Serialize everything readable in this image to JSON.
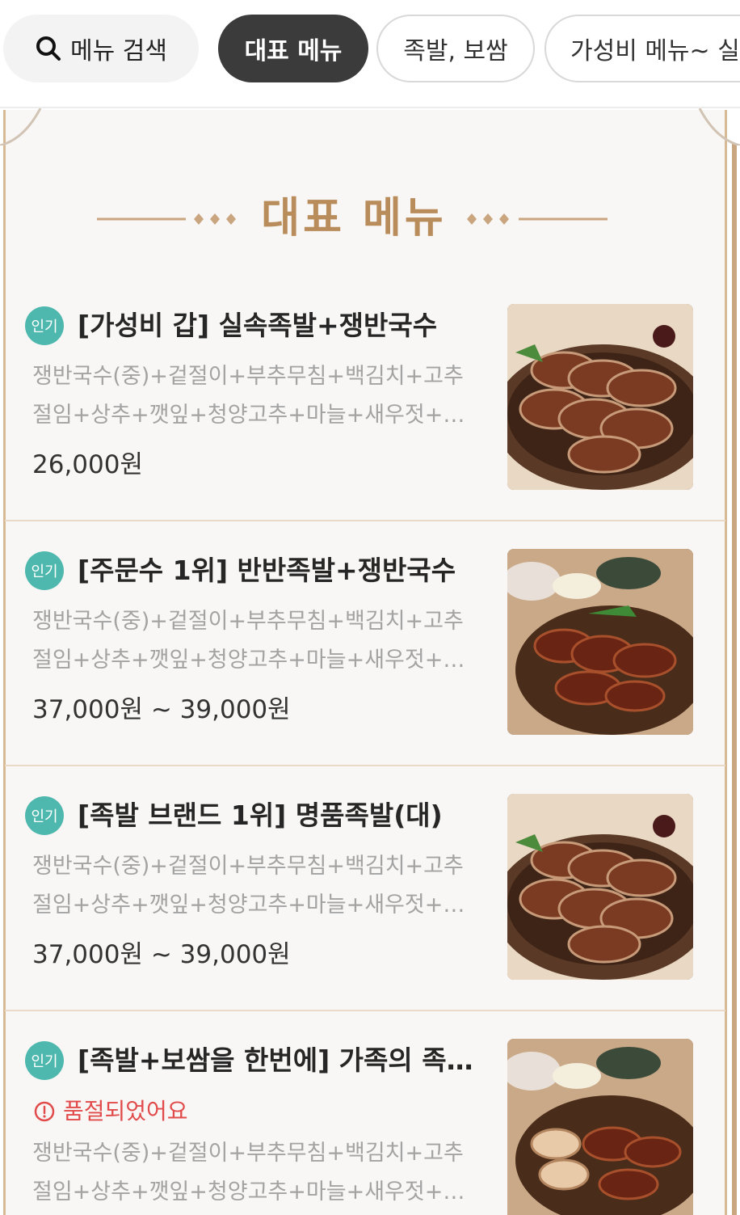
{
  "topbar": {
    "search_label": "메뉴 검색",
    "tabs": [
      "대표 메뉴",
      "족발, 보쌈",
      "가성비 메뉴~ 실속"
    ]
  },
  "section": {
    "title": "대표 메뉴"
  },
  "colors": {
    "accent": "#b98c5b",
    "badge": "#4fb8ae",
    "soldout": "#e14b4b",
    "active_tab": "#3b3b3b"
  },
  "menu_items": [
    {
      "badge": "인기",
      "title": "[가성비 갑] 실속족발+쟁반국수",
      "desc_line1": "쟁반국수(중)+겉절이+부추무침+백김치+고추",
      "desc_line2": "절임+상추+깻잎+청양고추+마늘+새우젓+…",
      "price": "26,000원",
      "status": ""
    },
    {
      "badge": "인기",
      "title": "[주문수 1위] 반반족발+쟁반국수",
      "desc_line1": "쟁반국수(중)+겉절이+부추무침+백김치+고추",
      "desc_line2": "절임+상추+깻잎+청양고추+마늘+새우젓+…",
      "price": "37,000원 ~ 39,000원",
      "status": ""
    },
    {
      "badge": "인기",
      "title": "[족발 브랜드 1위] 명품족발(대)",
      "desc_line1": "쟁반국수(중)+겉절이+부추무침+백김치+고추",
      "desc_line2": "절임+상추+깻잎+청양고추+마늘+새우젓+…",
      "price": "37,000원 ~ 39,000원",
      "status": ""
    },
    {
      "badge": "인기",
      "title": "[족발+보쌈을 한번에] 가족의 족…",
      "desc_line1": "쟁반국수(중)+겉절이+부추무침+백김치+고추",
      "desc_line2": "절임+상추+깻잎+청양고추+마늘+새우젓+…",
      "price": "",
      "status": "품절되었어요"
    }
  ]
}
